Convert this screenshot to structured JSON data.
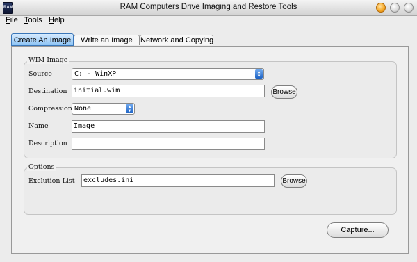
{
  "window": {
    "title": "RAM Computers Drive Imaging and Restore Tools",
    "icon_text": "RAM"
  },
  "menu": [
    "File",
    "Tools",
    "Help"
  ],
  "tabs": [
    "Create An Image",
    "Write an Image",
    "Network and Copying"
  ],
  "wim_group": {
    "legend": "WIM Image",
    "source_label": "Source",
    "source_value": "C: - WinXP",
    "destination_label": "Destination",
    "destination_value": "initial.wim",
    "destination_browse": "Browse",
    "compression_label": "Compression",
    "compression_value": "None",
    "name_label": "Name",
    "name_value": "Image",
    "description_label": "Description",
    "description_value": ""
  },
  "options_group": {
    "legend": "Options",
    "exclusion_label": "Exclution List",
    "exclusion_value": "excludes.ini",
    "exclusion_browse": "Browse"
  },
  "capture_button": "Capture..."
}
